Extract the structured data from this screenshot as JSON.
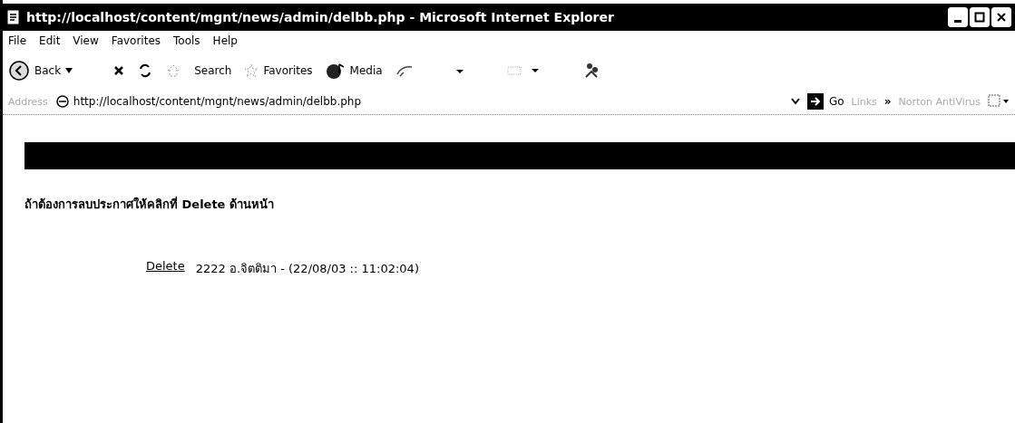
{
  "window": {
    "title": "http://localhost/content/mgnt/news/admin/delbb.php - Microsoft Internet Explorer"
  },
  "menu": [
    "File",
    "Edit",
    "View",
    "Favorites",
    "Tools",
    "Help"
  ],
  "toolbar": [
    {
      "kind": "back",
      "label": "Back"
    },
    {
      "kind": "stop"
    },
    {
      "kind": "refresh"
    },
    {
      "kind": "home"
    },
    {
      "kind": "search",
      "label": "Search"
    },
    {
      "kind": "favorites",
      "label": "Favorites"
    },
    {
      "kind": "media",
      "label": "Media"
    },
    {
      "kind": "history"
    },
    {
      "kind": "mail"
    },
    {
      "kind": "print"
    },
    {
      "kind": "messenger"
    }
  ],
  "address_bar": {
    "label": "Address",
    "url": "http://localhost/content/mgnt/news/admin/delbb.php",
    "go": "Go",
    "links": "Links",
    "chevron": "»",
    "extra": "Norton AntiVirus"
  },
  "page": {
    "instruction": "ถ้าต้องการลบประกาศให้คลิกที่ Delete ด้านหน้า",
    "entries": [
      {
        "action": "Delete",
        "text": "2222 อ.จิตติมา - (22/08/03 :: 11:02:04)"
      }
    ]
  }
}
